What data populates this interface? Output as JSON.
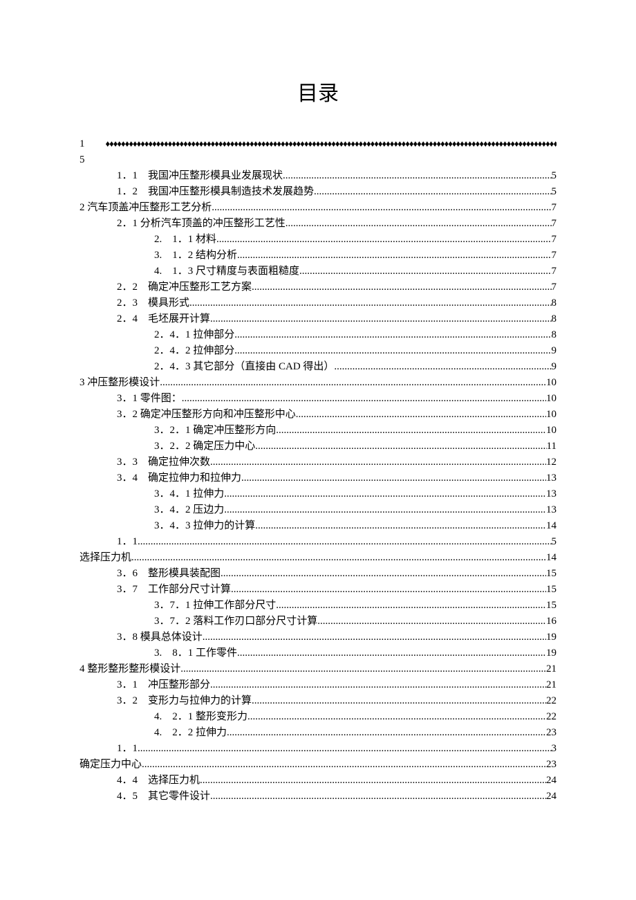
{
  "title": "目录",
  "entries": [
    {
      "level": "l0",
      "label": "1　　",
      "page": "",
      "fill": "diamond"
    },
    {
      "level": "l0",
      "label": "5",
      "page": "",
      "fill": "none"
    },
    {
      "level": "l1",
      "label": "1．1　我国冲压整形模具业发展现状 ",
      "page": "5",
      "fill": "dots"
    },
    {
      "level": "l1",
      "label": "1．2　我国冲压整形模具制造技术发展趋势 ",
      "page": "5",
      "fill": "dots"
    },
    {
      "level": "l0",
      "label": "2 汽车顶盖冲压整形工艺分析",
      "page": "7",
      "fill": "dots"
    },
    {
      "level": "l1",
      "label": "2．1 分析汽车顶盖的冲压整形工艺性 ",
      "page": "7",
      "fill": "dots"
    },
    {
      "level": "l2",
      "label": "2.　1．1 材料 ",
      "page": "7",
      "fill": "dots"
    },
    {
      "level": "l2",
      "label": "3.　1．2 结构分析 ",
      "page": "7",
      "fill": "dots"
    },
    {
      "level": "l2",
      "label": "4.　1．3 尺寸精度与表面粗糙度 ",
      "page": "7",
      "fill": "dots"
    },
    {
      "level": "l1",
      "label": "2．2　确定冲压整形工艺方案 ",
      "page": "7",
      "fill": "dots"
    },
    {
      "level": "l1",
      "label": "2．3　模具形式 ",
      "page": "8",
      "fill": "dots"
    },
    {
      "level": "l1",
      "label": "2．4　毛坯展开计算",
      "page": "8",
      "fill": "dots"
    },
    {
      "level": "l2",
      "label": "2．4．1 拉伸部分 ",
      "page": "8",
      "fill": "dots"
    },
    {
      "level": "l2",
      "label": "2．4．2 拉伸部分 ",
      "page": "9",
      "fill": "dots"
    },
    {
      "level": "l2",
      "label": "2．4．3 其它部分（直接由 CAD 得出）",
      "page": "9",
      "fill": "dots"
    },
    {
      "level": "l0",
      "label": "3 冲压整形模设计",
      "page": "10",
      "fill": "dots"
    },
    {
      "level": "l1",
      "label": "3．1 零件图： ",
      "page": "10",
      "fill": "dots"
    },
    {
      "level": "l1",
      "label": "3．2 确定冲压整形方向和冲压整形中心 ",
      "page": "10",
      "fill": "dots"
    },
    {
      "level": "l2",
      "label": "3．2．1 确定冲压整形方向 ",
      "page": "10",
      "fill": "dots"
    },
    {
      "level": "l2",
      "label": "3．2．2 确定压力中心 ",
      "page": "11",
      "fill": "dots"
    },
    {
      "level": "l1",
      "label": "3．3　确定拉伸次数",
      "page": "12",
      "fill": "dots"
    },
    {
      "level": "l1",
      "label": "3．4　确定拉伸力和拉伸力",
      "page": "13",
      "fill": "dots"
    },
    {
      "level": "l2",
      "label": "3．4．1 拉伸力 ",
      "page": "13",
      "fill": "dots"
    },
    {
      "level": "l2",
      "label": "3．4．2 压边力 ",
      "page": "13",
      "fill": "dots"
    },
    {
      "level": "l2",
      "label": "3．4．3 拉伸力的计算 ",
      "page": "14",
      "fill": "dots"
    },
    {
      "level": "l1",
      "label": "1．1 ",
      "page": "5",
      "fill": "dots"
    },
    {
      "level": "l0",
      "label": "选择压力机 ",
      "page": "14",
      "fill": "dots"
    },
    {
      "level": "l1",
      "label": "3．6　整形模具装配图",
      "page": "15",
      "fill": "dots"
    },
    {
      "level": "l1",
      "label": "3．7　工作部分尺寸计算",
      "page": "15",
      "fill": "dots"
    },
    {
      "level": "l2",
      "label": "3．7．1 拉伸工作部分尺寸 ",
      "page": "15",
      "fill": "dots"
    },
    {
      "level": "l2",
      "label": "3．7．2 落料工作刃口部分尺寸计算 ",
      "page": "16",
      "fill": "dots"
    },
    {
      "level": "l1",
      "label": "3．8 模具总体设计 ",
      "page": "19",
      "fill": "dots"
    },
    {
      "level": "l2",
      "label": "3.　8．1 工作零件 ",
      "page": "19",
      "fill": "dots"
    },
    {
      "level": "l0",
      "label": "4 整形整形整形模设计",
      "page": "21",
      "fill": "dots"
    },
    {
      "level": "l1",
      "label": "3．1　冲压整形部分 ",
      "page": "21",
      "fill": "dots"
    },
    {
      "level": "l1",
      "label": "3．2　变形力与拉伸力的计算",
      "page": "22",
      "fill": "dots"
    },
    {
      "level": "l2",
      "label": "4.　2．1 整形变形力 ",
      "page": "22",
      "fill": "dots"
    },
    {
      "level": "l2",
      "label": "4.　2．2 拉伸力",
      "page": "23",
      "fill": "dots"
    },
    {
      "level": "l1",
      "label": "1．1 ",
      "page": "3",
      "fill": "dots"
    },
    {
      "level": "l0",
      "label": "确定压力中心 ",
      "page": "23",
      "fill": "dots"
    },
    {
      "level": "l1",
      "label": "4．4　选择压力机",
      "page": "24",
      "fill": "dots"
    },
    {
      "level": "l1",
      "label": "4．5　其它零件设计",
      "page": "24",
      "fill": "dots"
    }
  ]
}
